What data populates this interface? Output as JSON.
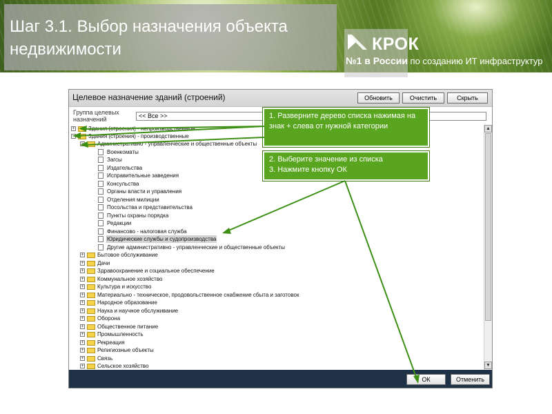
{
  "slide": {
    "title": "Шаг 3.1. Выбор назначения объекта недвижимости",
    "logo": {
      "name": "КРОК",
      "tagline_bold": "№1 в России",
      "tagline_rest": " по созданию ИТ инфраструктур"
    }
  },
  "app": {
    "window_title": "Целевое назначение зданий (строений)",
    "buttons": {
      "refresh": "Обновить",
      "clear": "Очистить",
      "hide": "Скрыть",
      "ok": "ОК",
      "cancel": "Отменить"
    },
    "filter": {
      "label": "Группа целевых назначений",
      "value": "<< Все >>"
    },
    "tree": {
      "n01": "Здания (строения) - непроизводственные",
      "n02": "Здания (строения) - производственные",
      "n03": "Административно - управленческие и общественные объекты",
      "n04": "Военкоматы",
      "n05": "Загсы",
      "n06": "Издательства",
      "n07": "Исправительные заведения",
      "n08": "Консульства",
      "n09": "Органы власти и управления",
      "n10": "Отделения милиции",
      "n11": "Посольства и представительства",
      "n12": "Пункты охраны порядка",
      "n13": "Редакции",
      "n14": "Финансово - налоговая служба",
      "n15": "Юридические службы и судопроизводства",
      "n16": "Другие административно - управленческие и общественные объекты",
      "n17": "Бытовое обслуживание",
      "n18": "Дачи",
      "n19": "Здравоохранение и социальное обеспечение",
      "n20": "Коммунальное хозяйство",
      "n21": "Культура и искусство",
      "n22": "Материально - техническое, продовольственное снабжение сбыта и заготовок",
      "n23": "Народное образование",
      "n24": "Наука и научное обслуживание",
      "n25": "Оборона",
      "n26": "Общественное питание",
      "n27": "Промышленность",
      "n28": "Рекреация",
      "n29": "Религиозные объекты",
      "n30": "Связь",
      "n31": "Сельское хозяйство"
    },
    "selected_item": "Юридические службы и судопроизводства"
  },
  "callouts": {
    "c1": "1. Разверните дерево списка нажимая на знак + слева от нужной категории",
    "c2_line1": "2. Выберите значение из списка",
    "c2_line2": "3. Нажмите кнопку ОК"
  },
  "colors": {
    "callout_bg": "#5aa520",
    "footer_bg": "#1f3146",
    "folder": "#f5d44a",
    "selected_bg": "#d3d3d3"
  },
  "icons": {
    "expand": "plus-box-icon",
    "collapse": "minus-box-icon",
    "folder": "folder-icon",
    "leaf": "document-icon"
  }
}
